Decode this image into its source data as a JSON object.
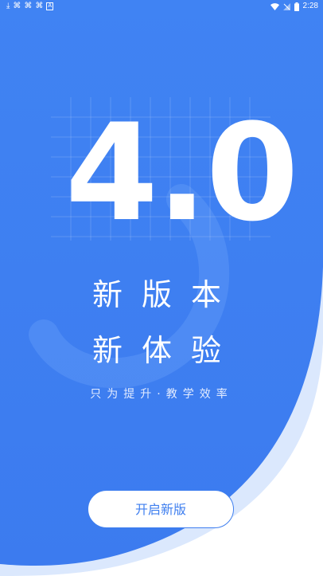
{
  "status_bar": {
    "left_icons": [
      "download-icon",
      "app-icon",
      "app-icon",
      "app-icon",
      "a-icon"
    ],
    "left_glyphs": [
      "⤓",
      "⌘",
      "⌘",
      "⌘",
      "A"
    ],
    "time": "2:28"
  },
  "hero": {
    "version": "4.0",
    "headline_line1": "新版本",
    "headline_line2": "新体验",
    "slogan": "只为提升·教学效率"
  },
  "action": {
    "start_label": "开启新版"
  },
  "colors": {
    "primary_blue": "#3f7fef",
    "light_blue": "#5a95f5",
    "white": "#ffffff"
  }
}
